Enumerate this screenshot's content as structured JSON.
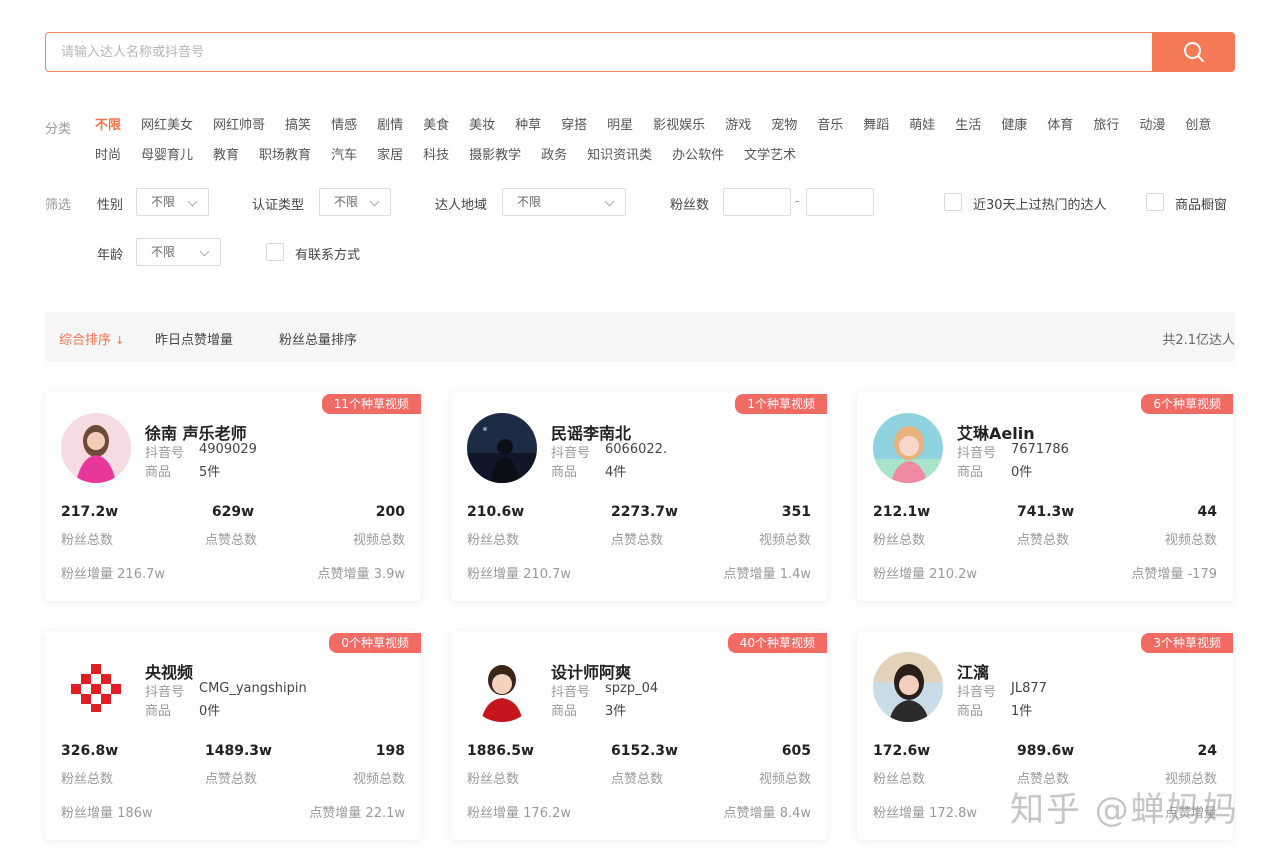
{
  "search": {
    "placeholder": "请输入达人名称或抖音号",
    "value": ""
  },
  "categories": {
    "label": "分类",
    "items": [
      "不限",
      "网红美女",
      "网红帅哥",
      "搞笑",
      "情感",
      "剧情",
      "美食",
      "美妆",
      "种草",
      "穿搭",
      "明星",
      "影视娱乐",
      "游戏",
      "宠物",
      "音乐",
      "舞蹈",
      "萌娃",
      "生活",
      "健康",
      "体育",
      "旅行",
      "动漫",
      "创意",
      "时尚",
      "母婴育儿",
      "教育",
      "职场教育",
      "汽车",
      "家居",
      "科技",
      "摄影教学",
      "政务",
      "知识资讯类",
      "办公软件",
      "文学艺术"
    ],
    "active": "不限"
  },
  "filters": {
    "label": "筛选",
    "gender_label": "性别",
    "gender_value": "不限",
    "cert_label": "认证类型",
    "cert_value": "不限",
    "region_label": "达人地域",
    "region_value": "不限",
    "fans_label": "粉丝数",
    "fans_sep": "-",
    "hot_label": "近30天上过热门的达人",
    "shop_label": "商品橱窗",
    "age_label": "年龄",
    "age_value": "不限",
    "contact_label": "有联系方式"
  },
  "sort": {
    "items": [
      "综合排序",
      "昨日点赞增量",
      "粉丝总量排序"
    ],
    "active_arrow": "↓",
    "total": "共2.1亿达人"
  },
  "labels": {
    "douyin_id": "抖音号",
    "goods": "商品",
    "fans_total": "粉丝总数",
    "likes_total": "点赞总数",
    "videos_total": "视频总数",
    "fans_inc": "粉丝增量",
    "likes_inc": "点赞增量"
  },
  "cards": [
    {
      "badge": "11个种草视频",
      "name": "徐南 声乐老师",
      "douyin_id": "4909029",
      "goods": "5件",
      "fans": "217.2w",
      "likes": "629w",
      "videos": "200",
      "fans_inc": "216.7w",
      "likes_inc": "3.9w"
    },
    {
      "badge": "1个种草视频",
      "name": "民谣李南北",
      "douyin_id": "6066022.",
      "goods": "4件",
      "fans": "210.6w",
      "likes": "2273.7w",
      "videos": "351",
      "fans_inc": "210.7w",
      "likes_inc": "1.4w"
    },
    {
      "badge": "6个种草视频",
      "name": "艾琳Aelin",
      "douyin_id": "7671786",
      "goods": "0件",
      "fans": "212.1w",
      "likes": "741.3w",
      "videos": "44",
      "fans_inc": "210.2w",
      "likes_inc": "-179"
    },
    {
      "badge": "0个种草视频",
      "name": "央视频",
      "douyin_id": "CMG_yangshipin",
      "goods": "0件",
      "fans": "326.8w",
      "likes": "1489.3w",
      "videos": "198",
      "fans_inc": "186w",
      "likes_inc": "22.1w"
    },
    {
      "badge": "40个种草视频",
      "name": "设计师阿爽",
      "douyin_id": "spzp_04",
      "goods": "3件",
      "fans": "1886.5w",
      "likes": "6152.3w",
      "videos": "605",
      "fans_inc": "176.2w",
      "likes_inc": "8.4w"
    },
    {
      "badge": "3个种草视频",
      "name": "江漓",
      "douyin_id": "JL877",
      "goods": "1件",
      "fans": "172.6w",
      "likes": "989.6w",
      "videos": "24",
      "fans_inc": "172.8w",
      "likes_inc": ""
    }
  ],
  "watermark": "知乎 @蝉妈妈"
}
